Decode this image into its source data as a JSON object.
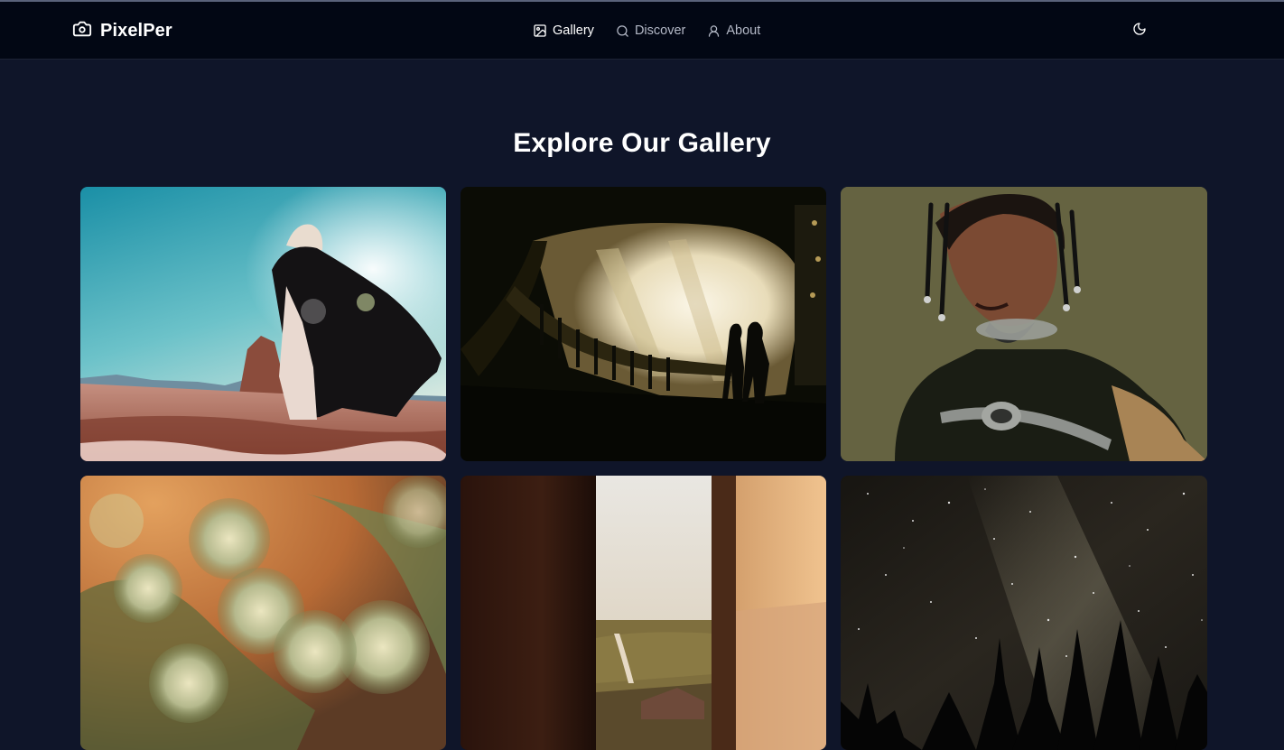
{
  "brand": {
    "name": "PixelPer",
    "icon": "camera-icon"
  },
  "nav": {
    "items": [
      {
        "label": "Gallery",
        "icon": "image-icon",
        "active": true
      },
      {
        "label": "Discover",
        "icon": "search-icon",
        "active": false
      },
      {
        "label": "About",
        "icon": "user-icon",
        "active": false
      }
    ]
  },
  "theme_toggle": {
    "icon": "moon-icon"
  },
  "page": {
    "title": "Explore Our Gallery"
  },
  "colors": {
    "background": "#0f1529",
    "navbar": "#020714",
    "text": "#ffffff",
    "muted_text": "#b4b9c7"
  }
}
